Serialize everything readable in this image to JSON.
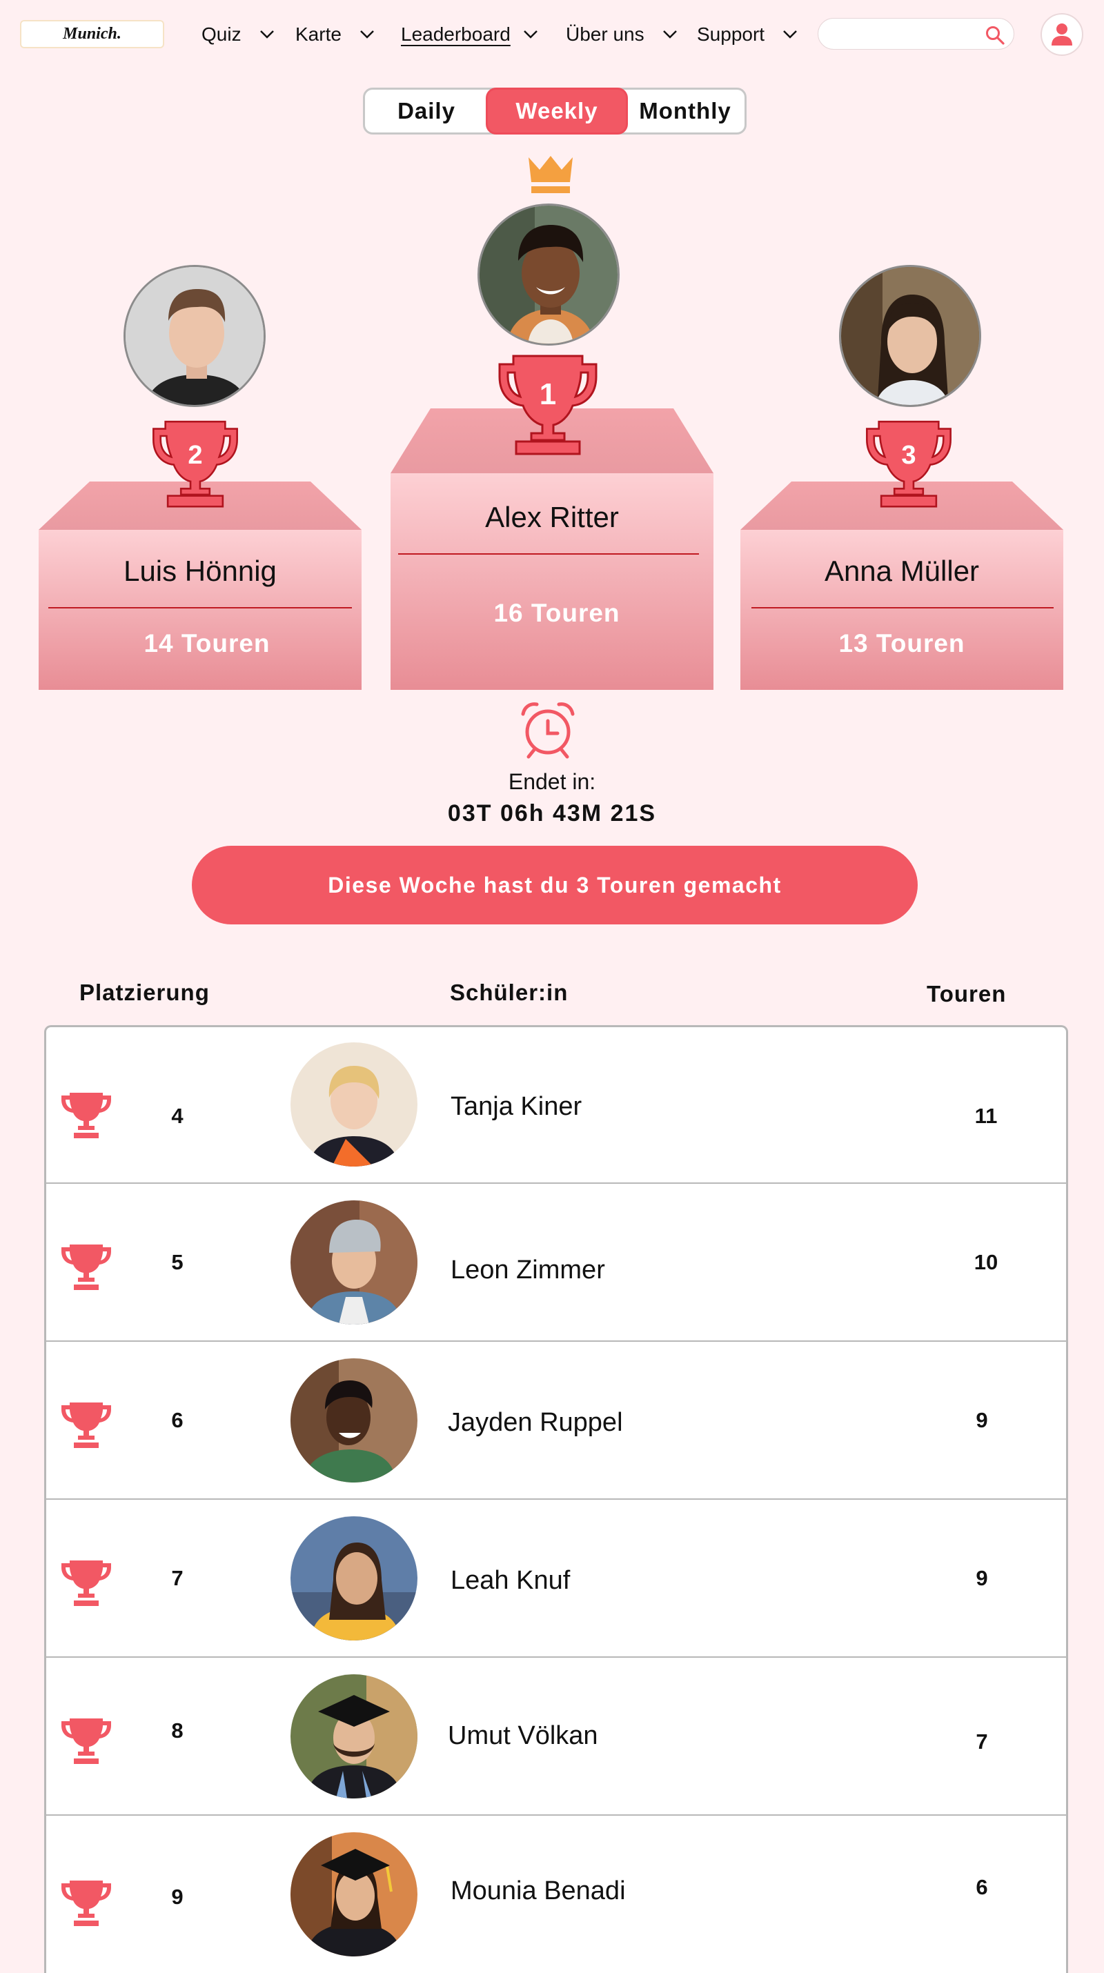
{
  "nav": {
    "logo": "Munich.",
    "items": [
      {
        "label": "Quiz"
      },
      {
        "label": "Karte"
      },
      {
        "label": "Leaderboard"
      },
      {
        "label": "Über uns"
      },
      {
        "label": "Support"
      }
    ],
    "search_placeholder": "",
    "search_icon": "search-icon",
    "profile_icon": "user-icon"
  },
  "tabs": [
    {
      "label": "Daily",
      "active": false
    },
    {
      "label": "Weekly",
      "active": true
    },
    {
      "label": "Monthly",
      "active": false
    }
  ],
  "podium": {
    "first": {
      "rank": "1",
      "name": "Alex Ritter",
      "score": "16 Touren"
    },
    "second": {
      "rank": "2",
      "name": "Luis Hönnig",
      "score": "14 Touren"
    },
    "third": {
      "rank": "3",
      "name": "Anna Müller",
      "score": "13 Touren"
    },
    "crown_icon": "crown-icon"
  },
  "timer": {
    "label": "Endet in:",
    "countdown": "03T 06h 43M 21S",
    "icon": "alarm-clock-icon"
  },
  "banner": "Diese Woche hast du 3 Touren gemacht",
  "table": {
    "headers": {
      "rank": "Platzierung",
      "student": "Schüler:in",
      "score": "Touren"
    },
    "rows": [
      {
        "rank": "4",
        "name": "Tanja Kiner",
        "score": "11"
      },
      {
        "rank": "5",
        "name": "Leon Zimmer",
        "score": "10"
      },
      {
        "rank": "6",
        "name": "Jayden Ruppel",
        "score": "9"
      },
      {
        "rank": "7",
        "name": "Leah Knuf",
        "score": "9"
      },
      {
        "rank": "8",
        "name": "Umut Völkan",
        "score": "7"
      },
      {
        "rank": "9",
        "name": "Mounia Benadi",
        "score": "6"
      }
    ]
  },
  "colors": {
    "accent": "#f25864",
    "background": "#fff0f2",
    "podium_top": "#fdd0d4",
    "podium_bottom": "#e88d95",
    "crown": "#f4a040"
  }
}
